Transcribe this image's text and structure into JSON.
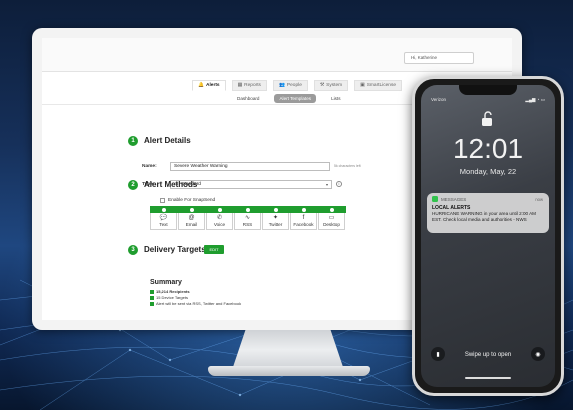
{
  "app": {
    "user_menu": "Hi, Katherine",
    "nav": [
      {
        "label": "Alerts",
        "icon": "bell-icon",
        "glyph": "🔔",
        "active": true
      },
      {
        "label": "Reports",
        "icon": "chart-icon",
        "glyph": "▦",
        "active": false
      },
      {
        "label": "People",
        "icon": "people-icon",
        "glyph": "👥",
        "active": false
      },
      {
        "label": "System",
        "icon": "tools-icon",
        "glyph": "⚒",
        "active": false
      },
      {
        "label": "SmartLicense",
        "icon": "license-icon",
        "glyph": "▣",
        "active": false
      }
    ],
    "subnav": [
      {
        "label": "Dashboard",
        "active": false
      },
      {
        "label": "Alert Templates",
        "active": true
      },
      {
        "label": "Lists",
        "active": false
      }
    ]
  },
  "alert_details": {
    "step": "1",
    "title": "Alert Details",
    "name_label": "Name:",
    "name_value": "Severe Weather Warning",
    "name_hint": "5k characters left",
    "type_label": "Type:",
    "type_value": "Standard",
    "type_icon": "warning-icon",
    "snap_label": "Enable For SnapSend"
  },
  "alert_methods": {
    "step": "2",
    "title": "Alert Methods",
    "methods": [
      {
        "label": "Text",
        "icon": "chat-icon",
        "glyph": "💬"
      },
      {
        "label": "Email",
        "icon": "email-icon",
        "glyph": "@"
      },
      {
        "label": "Voice",
        "icon": "phone-icon",
        "glyph": "✆"
      },
      {
        "label": "RSS",
        "icon": "rss-icon",
        "glyph": "∿"
      },
      {
        "label": "Twitter",
        "icon": "twitter-icon",
        "glyph": "✦"
      },
      {
        "label": "Facebook",
        "icon": "facebook-icon",
        "glyph": "f"
      },
      {
        "label": "Desktop",
        "icon": "desktop-icon",
        "glyph": "▭"
      }
    ]
  },
  "delivery_targets": {
    "step": "3",
    "title": "Delivery Targets",
    "button": "EDIT"
  },
  "summary": {
    "title": "Summary",
    "lines": [
      "15,214  Recipients",
      "15 Device Targets",
      "Alert will be sent via RSS, Twitter and Facebook"
    ]
  },
  "phone": {
    "carrier": "Verizon",
    "status": "▂▄▆ ◔ ▭",
    "time": "12:01",
    "date": "Monday, May, 22",
    "notification": {
      "app": "MESSAGES",
      "time": "now",
      "title": "LOCAL ALERTS",
      "body": "HURRICANE WARNING in your area until 2:00 AM EST. Check local media and authorities - NWS"
    },
    "swipe": "Swipe up to open"
  }
}
